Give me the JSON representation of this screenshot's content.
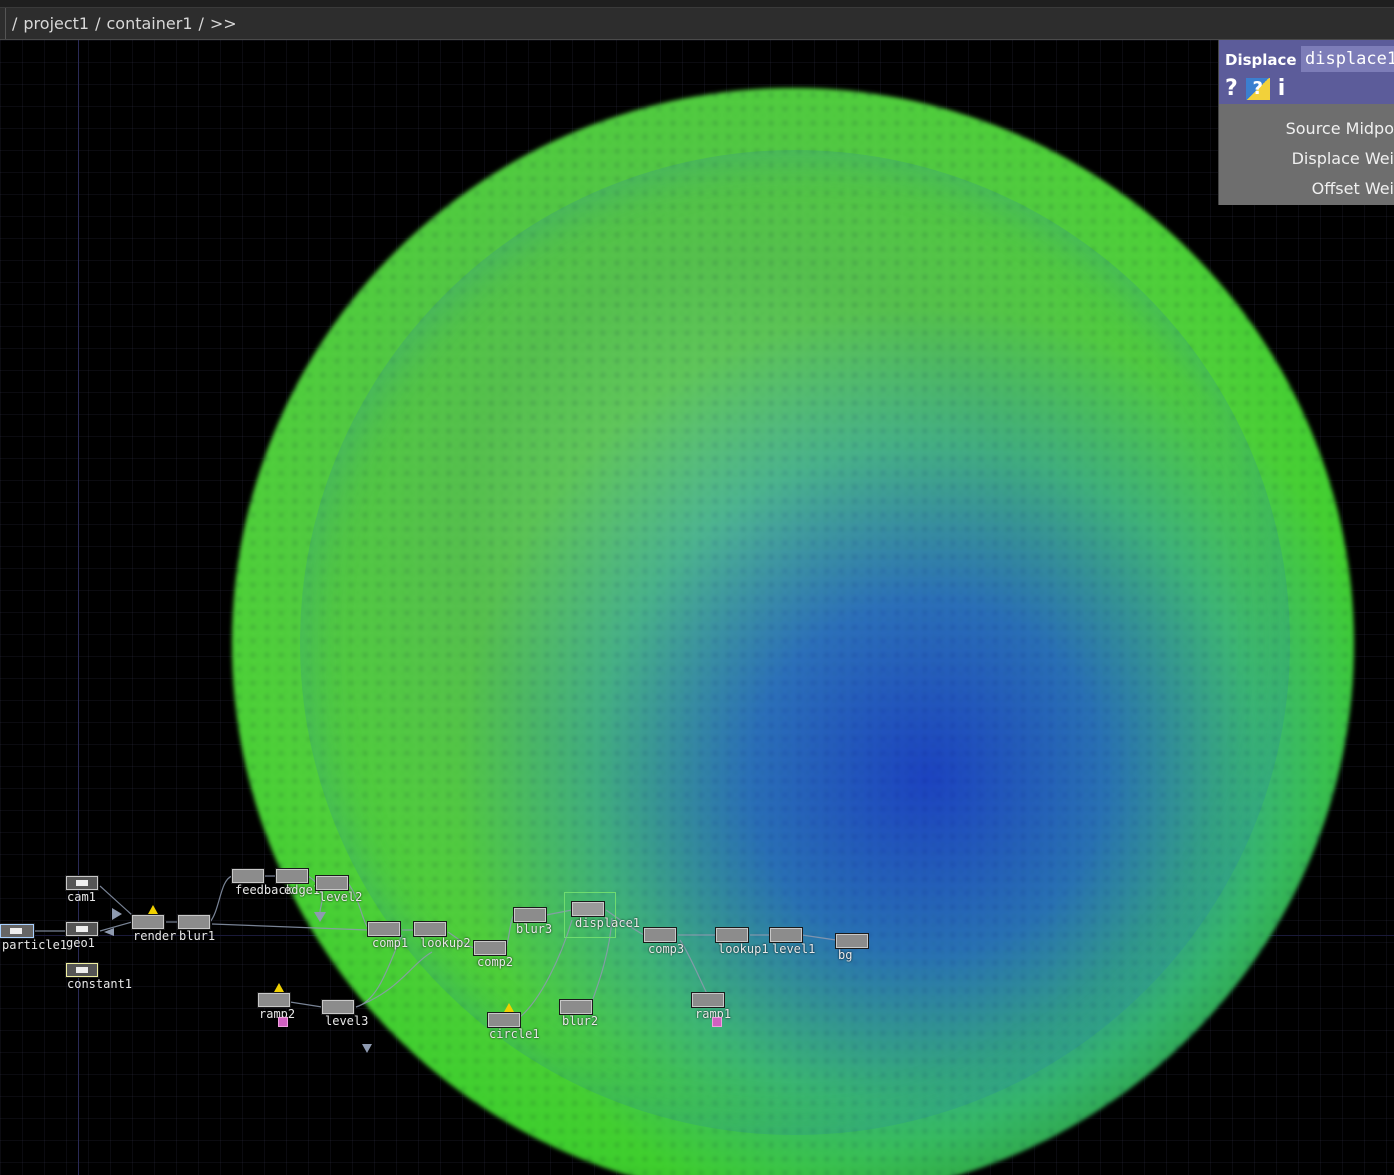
{
  "breadcrumb": {
    "root_sep": "/",
    "items": [
      "project1",
      "container1"
    ],
    "sep": "/",
    "more": ">>"
  },
  "nodes": {
    "cam1": "cam1",
    "geo1": "geo1",
    "particle1": "particle1",
    "constant1": "constant1",
    "render": "render",
    "blur1": "blur1",
    "feedback": "feedback",
    "edge1": "edge1",
    "level2": "level2",
    "comp1": "comp1",
    "lookup2": "lookup2",
    "comp2": "comp2",
    "blur3": "blur3",
    "displace1": "displace1",
    "comp3": "comp3",
    "lookup1": "lookup1",
    "level1": "level1",
    "bg": "bg",
    "ramp2": "ramp2",
    "level3": "level3",
    "circle1": "circle1",
    "blur2": "blur2",
    "ramp1": "ramp1"
  },
  "panel": {
    "op_type": "Displace",
    "op_name": "displace1",
    "help_icon": "?",
    "python_help_icon": "?",
    "info_icon": "i",
    "params": [
      "Source Midpo",
      "Displace Wei",
      "Offset Wei"
    ]
  },
  "colors": {
    "panel_header": "#5c5c9a",
    "panel_body": "#6e6e6e",
    "warning": "#f0d000",
    "selection": "#6fdc6f"
  }
}
